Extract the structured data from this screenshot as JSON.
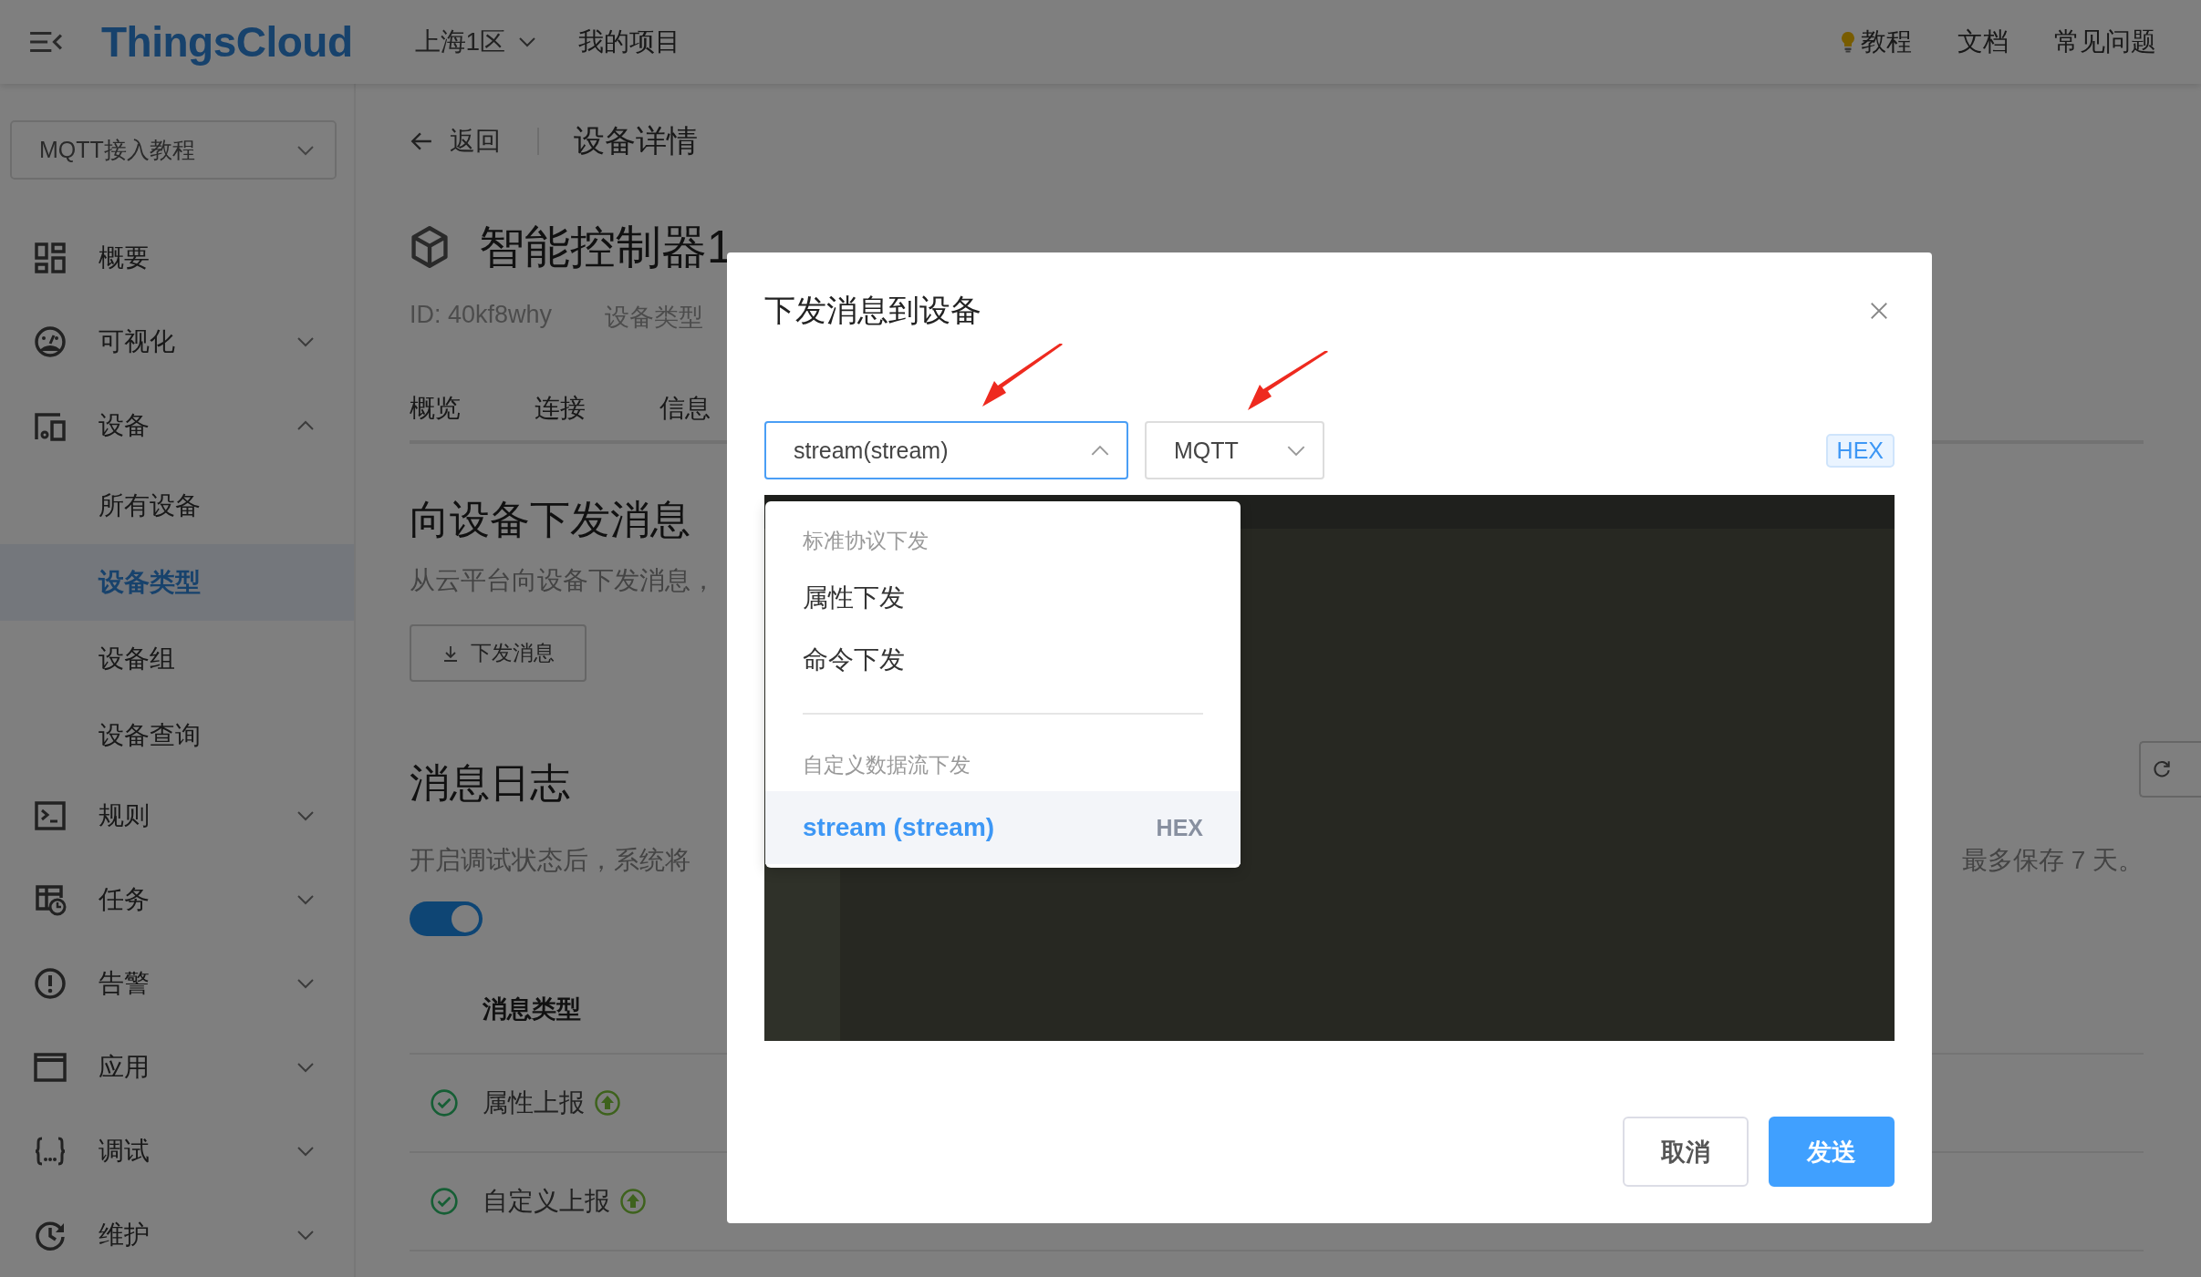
{
  "header": {
    "brand": "ThingsCloud",
    "region": "上海1区",
    "project_link": "我的项目",
    "links": [
      {
        "label": "教程",
        "kind": "tip"
      },
      {
        "label": "文档",
        "kind": "plain"
      },
      {
        "label": "常见问题",
        "kind": "plain"
      }
    ]
  },
  "sidebar": {
    "project": "MQTT接入教程",
    "items": [
      {
        "label": "概要",
        "kind": "link"
      },
      {
        "label": "可视化",
        "kind": "group",
        "expanded": false
      },
      {
        "label": "设备",
        "kind": "group",
        "expanded": true,
        "children": [
          {
            "label": "所有设备",
            "selected": false
          },
          {
            "label": "设备类型",
            "selected": true
          },
          {
            "label": "设备组",
            "selected": false
          },
          {
            "label": "设备查询",
            "selected": false
          }
        ]
      },
      {
        "label": "规则",
        "kind": "group",
        "expanded": false
      },
      {
        "label": "任务",
        "kind": "group",
        "expanded": false
      },
      {
        "label": "告警",
        "kind": "group",
        "expanded": false
      },
      {
        "label": "应用",
        "kind": "group",
        "expanded": false
      },
      {
        "label": "调试",
        "kind": "group",
        "expanded": false
      },
      {
        "label": "维护",
        "kind": "group",
        "expanded": false
      }
    ]
  },
  "content": {
    "back": "返回",
    "page_title": "设备详情",
    "device": {
      "name": "智能控制器1",
      "id": "ID: 40kf8why",
      "type_label": "设备类型"
    },
    "tabs": [
      {
        "label": "概览",
        "selected": false
      },
      {
        "label": "连接",
        "selected": false
      },
      {
        "label": "信息",
        "selected": false
      }
    ],
    "downlink": {
      "title": "向设备下发消息",
      "description": "从云平台向设备下发消息，",
      "button": "下发消息"
    },
    "log": {
      "title": "消息日志",
      "description": "开启调试状态后，系统将",
      "description_end": "最多保存 7 天。",
      "debug_toggle": {
        "on": true
      },
      "columns": [
        "消息类型"
      ],
      "rows": [
        {
          "message_type": "属性上报"
        },
        {
          "message_type": "自定义上报"
        }
      ]
    }
  },
  "modal": {
    "title": "下发消息到设备",
    "protocol_select": {
      "value": "stream(stream)",
      "open": true
    },
    "transport_select": {
      "value": "MQTT",
      "open": false
    },
    "format_tag": "HEX",
    "dropdown": [
      {
        "group": "标准协议下发",
        "options": [
          {
            "label": "属性下发",
            "selected": false
          },
          {
            "label": "命令下发",
            "selected": false
          }
        ]
      },
      {
        "group": "自定义数据流下发",
        "options": [
          {
            "label": "stream (stream)",
            "selected": true,
            "tag": "HEX"
          }
        ]
      }
    ],
    "buttons": [
      {
        "label": "取消",
        "kind": "default"
      },
      {
        "label": "发送",
        "kind": "primary"
      }
    ]
  }
}
